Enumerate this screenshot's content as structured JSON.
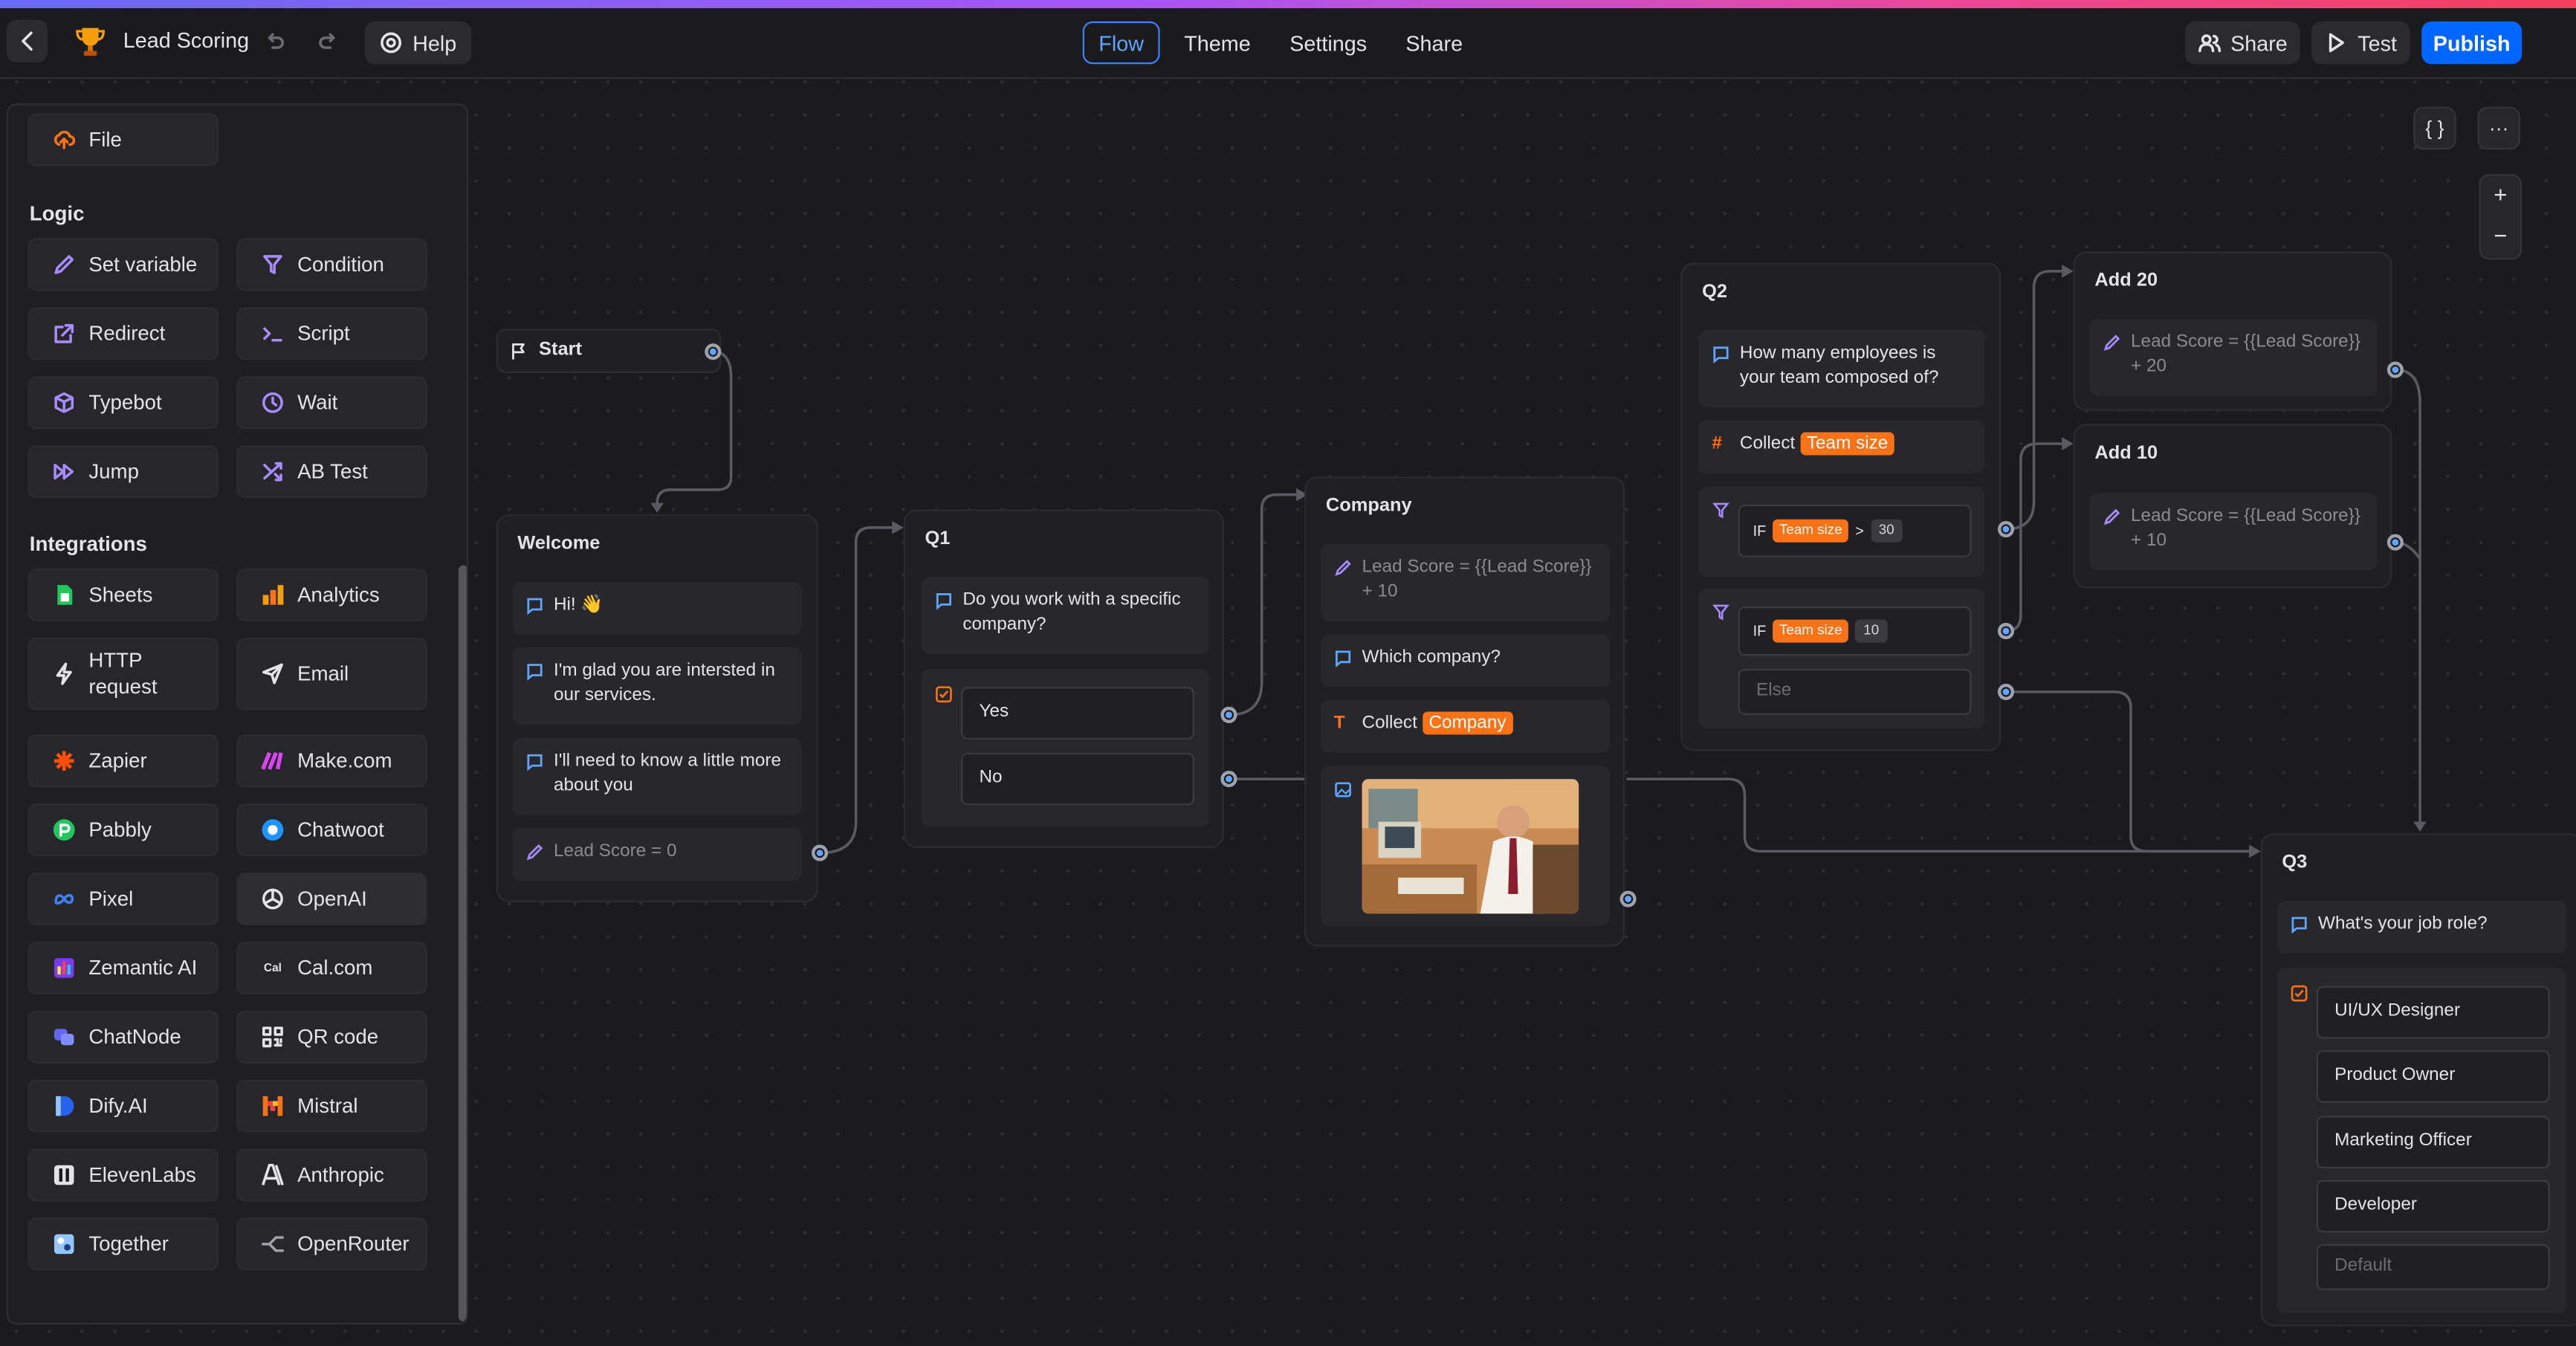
{
  "header": {
    "title": "Lead Scoring",
    "help_label": "Help",
    "tabs": [
      "Flow",
      "Theme",
      "Settings",
      "Share"
    ],
    "share_label": "Share",
    "test_label": "Test",
    "publish_label": "Publish"
  },
  "sidebar": {
    "file_label": "File",
    "logic_title": "Logic",
    "logic": [
      "Set variable",
      "Condition",
      "Redirect",
      "Script",
      "Typebot",
      "Wait",
      "Jump",
      "AB Test"
    ],
    "integrations_title": "Integrations",
    "integrations": [
      "Sheets",
      "Analytics",
      "HTTP request",
      "Email",
      "Zapier",
      "Make.com",
      "Pabbly",
      "Chatwoot",
      "Pixel",
      "OpenAI",
      "Zemantic AI",
      "Cal.com",
      "ChatNode",
      "QR code",
      "Dify.AI",
      "Mistral",
      "ElevenLabs",
      "Anthropic",
      "Together",
      "OpenRouter"
    ]
  },
  "canvas": {
    "start": {
      "title": "Start"
    },
    "welcome": {
      "title": "Welcome",
      "msg1": "Hi! 👋",
      "msg2": "I'm glad you are intersted in our services.",
      "msg3": "I'll need to know a little more about you",
      "set": "Lead Score = 0"
    },
    "q1": {
      "title": "Q1",
      "question": "Do you work with a specific company?",
      "options": [
        "Yes",
        "No"
      ]
    },
    "company": {
      "title": "Company",
      "set": "Lead Score = {{Lead Score}} + 10",
      "question": "Which company?",
      "collect_label": "Collect",
      "collect_var": "Company"
    },
    "q2": {
      "title": "Q2",
      "question": "How many employees is your team composed of?",
      "collect_label": "Collect",
      "collect_var": "Team size",
      "cond1": {
        "if": "IF",
        "var": "Team size",
        "op": ">",
        "val": "30"
      },
      "cond2": {
        "if": "IF",
        "var": "Team size",
        "val": "10"
      },
      "else": "Else"
    },
    "add20": {
      "title": "Add 20",
      "set": "Lead Score = {{Lead Score}} + 20"
    },
    "add10": {
      "title": "Add 10",
      "set": "Lead Score = {{Lead Score}} + 10"
    },
    "q3": {
      "title": "Q3",
      "question": "What's your job role?",
      "options": [
        "UI/UX Designer",
        "Product Owner",
        "Marketing Officer",
        "Developer"
      ],
      "default": "Default"
    },
    "tools": {
      "json": "{ }",
      "more": "···",
      "zoom_in": "+",
      "zoom_out": "−"
    }
  },
  "colors": {
    "accent": "#0066ff",
    "tab_active": "#3b82f6",
    "variable_tag": "#f97316",
    "background": "#1b1b1e"
  }
}
